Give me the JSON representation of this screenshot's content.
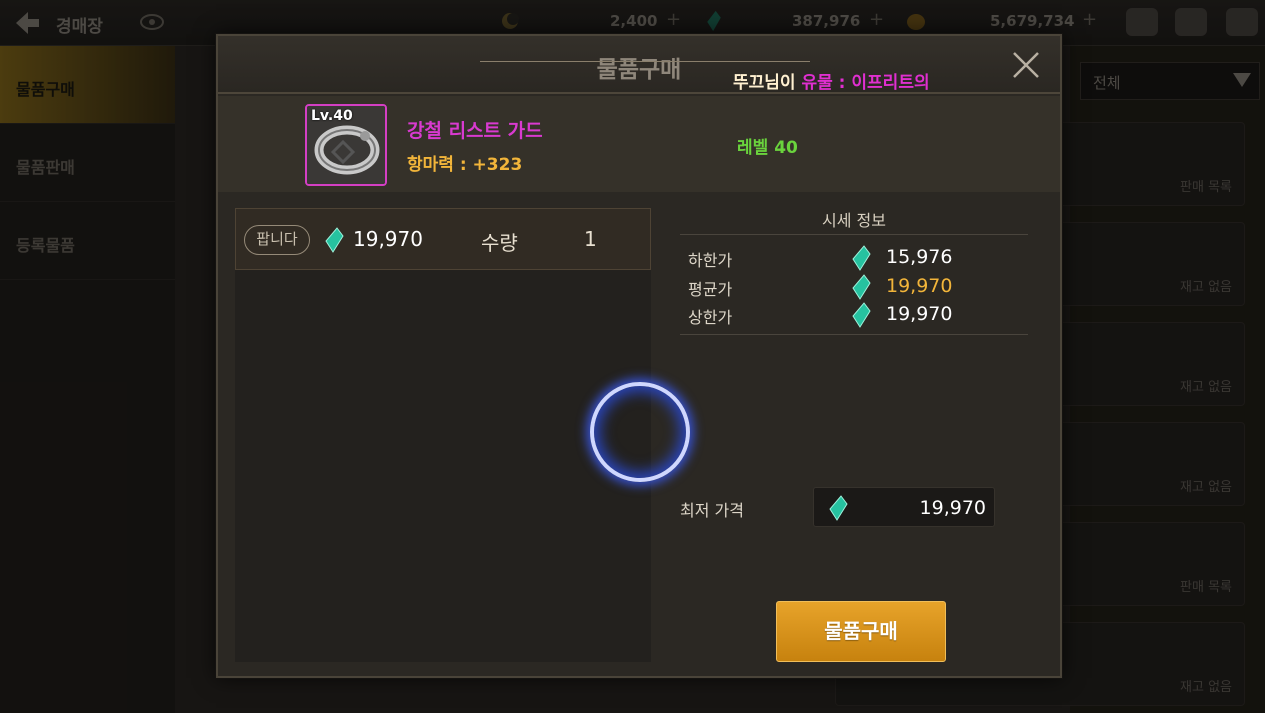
{
  "background": {
    "screen_title": "경매장",
    "currencies": [
      {
        "icon": "moon-coin-icon",
        "value": "2,400"
      },
      {
        "icon": "gem-icon",
        "value": "387,976"
      },
      {
        "icon": "gold-icon",
        "value": "5,679,734"
      }
    ],
    "sidebar_items": [
      "물품구매",
      "물품판매",
      "등록물품"
    ],
    "filter_value": "전체",
    "row_labels": [
      "판매 목록",
      "재고 없음",
      "재고 없음",
      "재고 없음",
      "판매 목록",
      "재고 없음"
    ]
  },
  "dialog": {
    "title": "물품구매",
    "notice": {
      "prefix": "뚜끄님이 ",
      "highlight": "유물 : 이프리트의"
    },
    "item": {
      "level_badge": "Lv.40",
      "name": "강철 리스트 가드",
      "stat": "항마력 : +323",
      "required_level": "레벨 40"
    },
    "listing": {
      "badge": "팝니다",
      "price": "19,970",
      "quantity_label": "수량",
      "quantity": "1"
    },
    "market": {
      "title": "시세 정보",
      "rows": [
        {
          "label": "하한가",
          "value": "15,976"
        },
        {
          "label": "평균가",
          "value": "19,970"
        },
        {
          "label": "상한가",
          "value": "19,970"
        }
      ]
    },
    "min_price": {
      "label": "최저 가격",
      "value": "19,970"
    },
    "buy_button": "물품구매"
  },
  "colors": {
    "epic_purple": "#d93ad0",
    "gold_text": "#f2b53a",
    "level_green": "#6ad33d",
    "buy_button": "#e0981e"
  }
}
